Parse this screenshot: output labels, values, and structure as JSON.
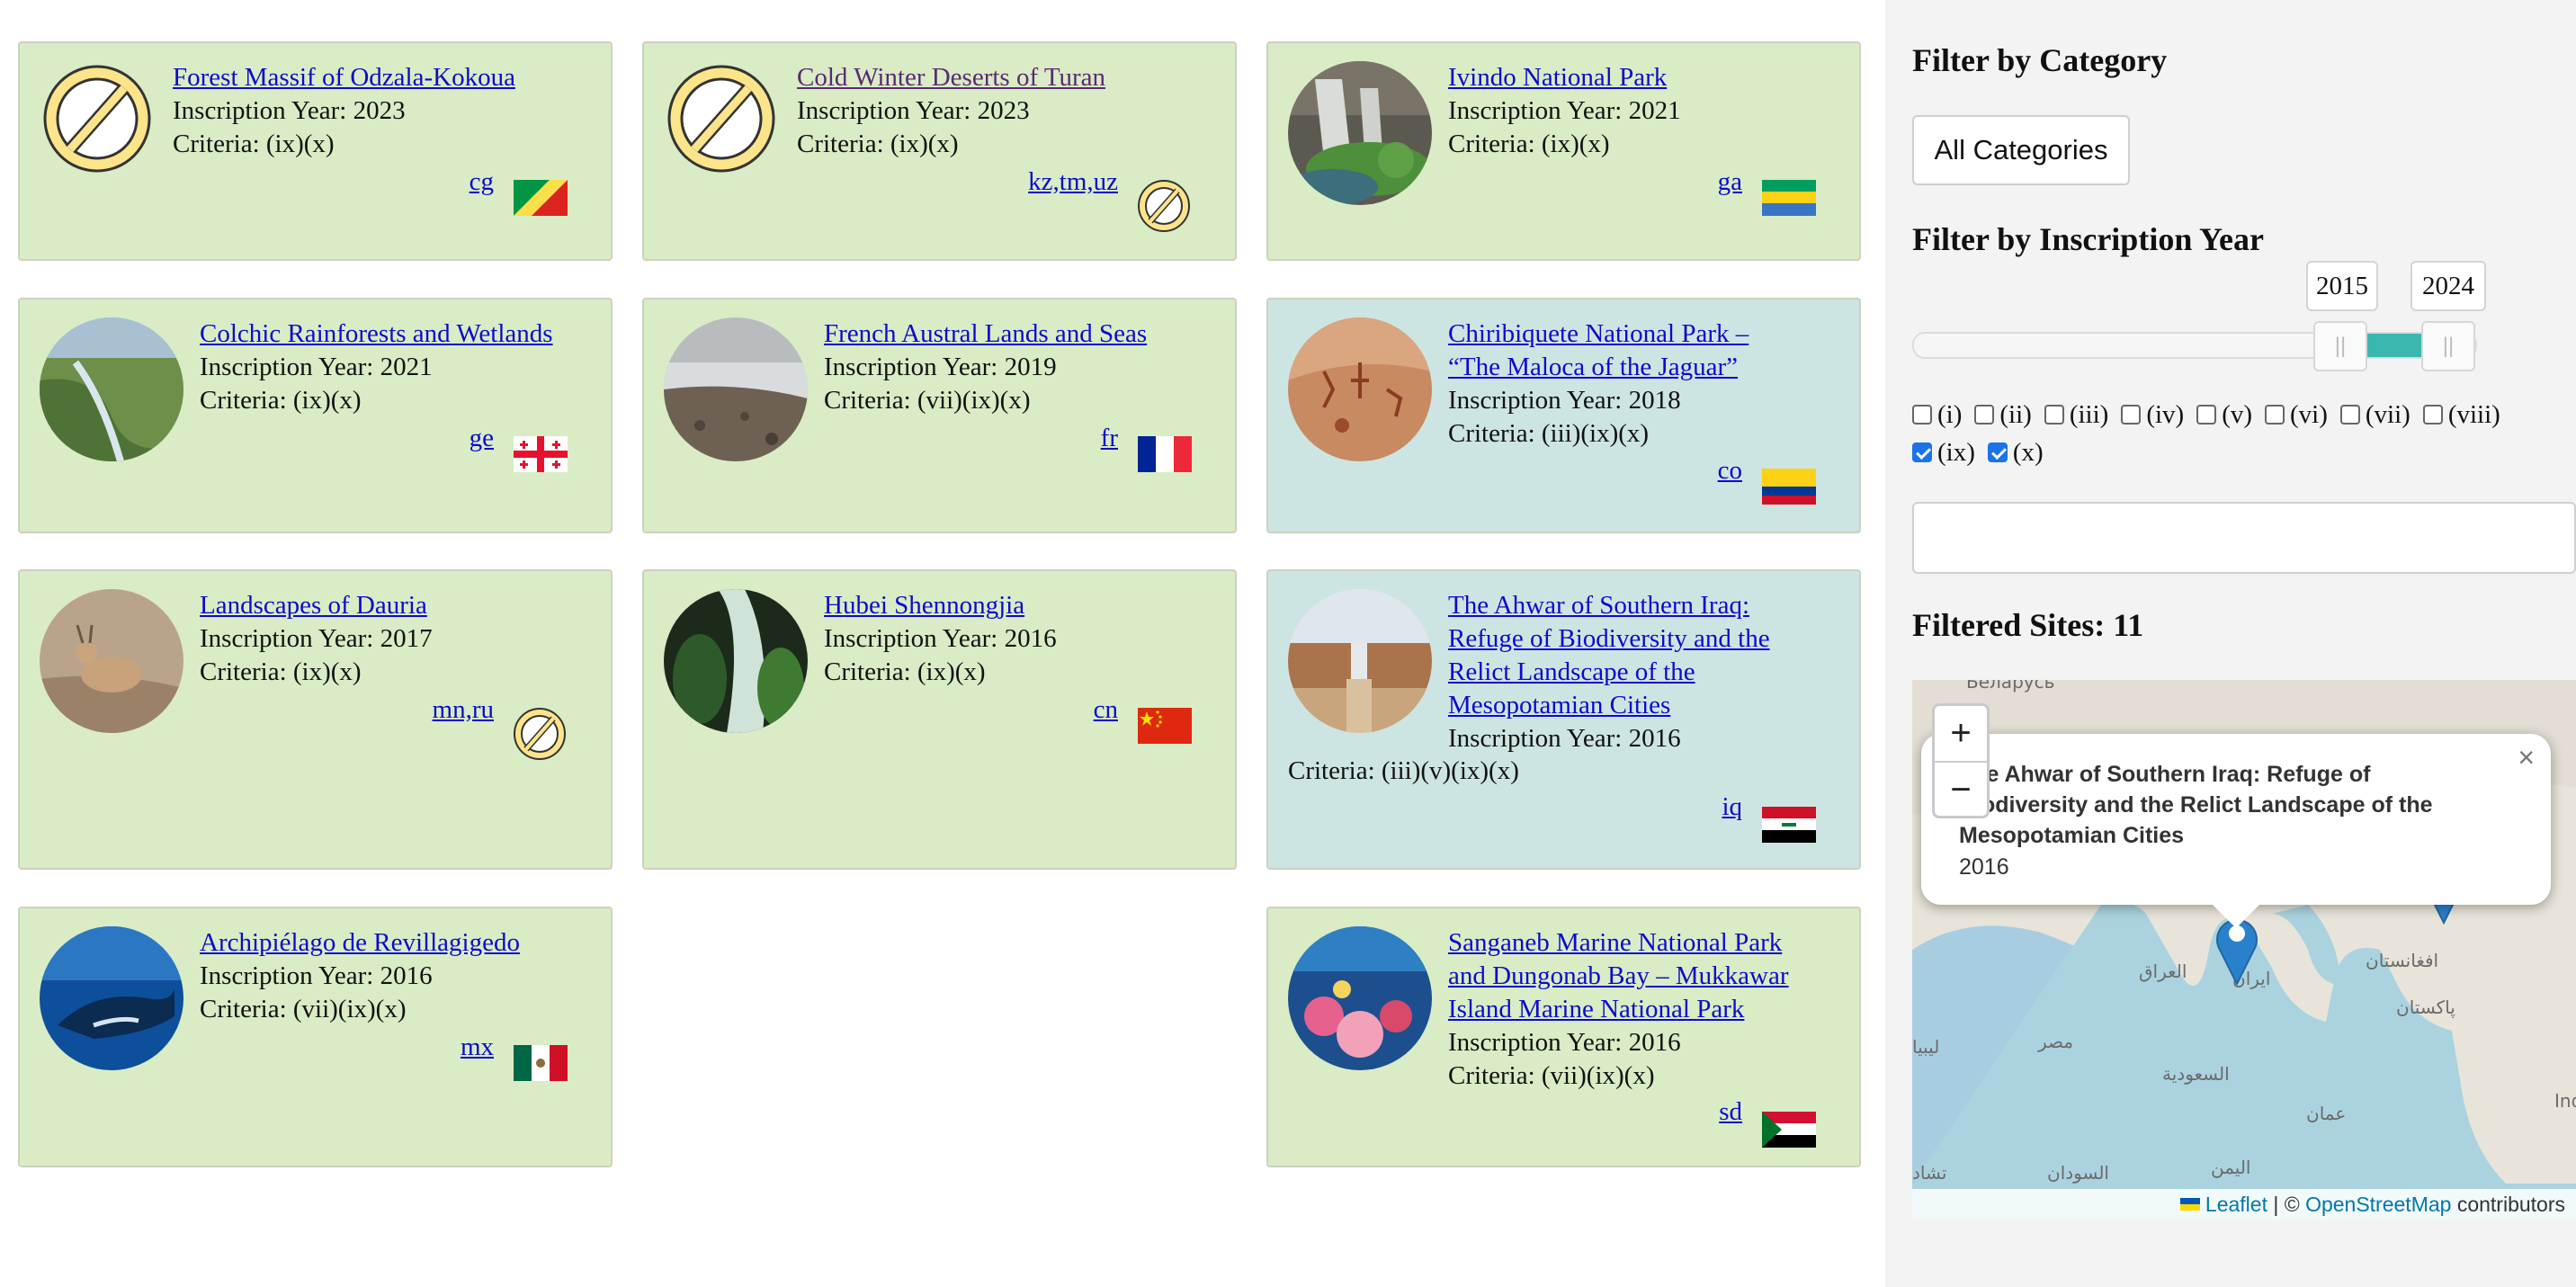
{
  "sites": [
    {
      "name": "Forest Massif of Odzala-Kokoua",
      "year_text": "Inscription Year: 2023",
      "criteria_text": "Criteria: (ix)(x)",
      "codes": "cg",
      "category": "natural",
      "image": "no-image-icon",
      "flag": "flag-cg"
    },
    {
      "name": "Cold Winter Deserts of Turan",
      "year_text": "Inscription Year: 2023",
      "criteria_text": "Criteria: (ix)(x)",
      "codes": "kz,tm,uz",
      "category": "natural",
      "image": "no-image-icon",
      "flag": "no-flag-icon"
    },
    {
      "name": "Ivindo National Park",
      "year_text": "Inscription Year: 2021",
      "criteria_text": "Criteria: (ix)(x)",
      "codes": "ga",
      "category": "natural",
      "image": "waterfall-photo",
      "flag": "flag-ga"
    },
    {
      "name": "Colchic Rainforests and Wetlands",
      "year_text": "Inscription Year: 2021",
      "criteria_text": "Criteria: (ix)(x)",
      "codes": "ge",
      "category": "natural",
      "image": "wetland-photo",
      "flag": "flag-ge"
    },
    {
      "name": "French Austral Lands and Seas",
      "year_text": "Inscription Year: 2019",
      "criteria_text": "Criteria: (vii)(ix)(x)",
      "codes": "fr",
      "category": "natural",
      "image": "coast-photo",
      "flag": "flag-fr"
    },
    {
      "name_lines": [
        "Chiribiquete National Park –",
        "“The Maloca of the Jaguar”"
      ],
      "year_text": "Inscription Year: 2018",
      "criteria_text": "Criteria: (iii)(ix)(x)",
      "codes": "co",
      "category": "mixed",
      "image": "rock-art-photo",
      "flag": "flag-co"
    },
    {
      "name": "Landscapes of Dauria",
      "year_text": "Inscription Year: 2017",
      "criteria_text": "Criteria: (ix)(x)",
      "codes": "mn,ru",
      "category": "natural",
      "image": "gazelle-photo",
      "flag": "no-flag-icon"
    },
    {
      "name": "Hubei Shennongjia",
      "year_text": "Inscription Year: 2016",
      "criteria_text": "Criteria: (ix)(x)",
      "codes": "cn",
      "category": "natural",
      "image": "cave-photo",
      "flag": "flag-cn"
    },
    {
      "name_lines": [
        "The Ahwar of Southern Iraq:",
        "Refuge of Biodiversity and the",
        "Relict Landscape of the",
        "Mesopotamian Cities"
      ],
      "year_text": "Inscription Year: 2016",
      "criteria_text": "Criteria: (iii)(v)(ix)(x)",
      "codes": "iq",
      "category": "mixed",
      "image": "ruins-photo",
      "flag": "flag-iq"
    },
    {
      "name": "Archipiélago de Revillagigedo",
      "year_text": "Inscription Year: 2016",
      "criteria_text": "Criteria: (vii)(ix)(x)",
      "codes": "mx",
      "category": "natural",
      "image": "whale-photo",
      "flag": "flag-mx"
    },
    {
      "name_lines": [
        "Sanganeb Marine National Park",
        "and Dungonab Bay – Mukkawar",
        "Island Marine National Park"
      ],
      "year_text": "Inscription Year: 2016",
      "criteria_text": "Criteria: (vii)(ix)(x)",
      "codes": "sd",
      "category": "natural",
      "image": "coral-photo",
      "flag": "flag-sd"
    }
  ],
  "sidebar": {
    "category_heading": "Filter by Category",
    "category_select": "All Categories",
    "year_heading": "Filter by Inscription Year",
    "year_from": "2015",
    "year_to": "2024",
    "year_range_fraction": [
      0.85,
      1.0
    ],
    "criteria": [
      {
        "label": "(i)",
        "checked": false
      },
      {
        "label": "(ii)",
        "checked": false
      },
      {
        "label": "(iii)",
        "checked": false
      },
      {
        "label": "(iv)",
        "checked": false
      },
      {
        "label": "(v)",
        "checked": false
      },
      {
        "label": "(vi)",
        "checked": false
      },
      {
        "label": "(vii)",
        "checked": false
      },
      {
        "label": "(viii)",
        "checked": false
      },
      {
        "label": "(ix)",
        "checked": true
      },
      {
        "label": "(x)",
        "checked": true
      }
    ],
    "search_value": "",
    "filtered_text": "Filtered Sites: 11"
  },
  "map": {
    "zoom_in": "+",
    "zoom_out": "−",
    "popup_title": "The Ahwar of Southern Iraq: Refuge of Biodiversity and the Relict Landscape of the Mesopotamian Cities",
    "popup_year": "2016",
    "popup_close": "×",
    "labels": {
      "belarus": "Беларусь",
      "iraq": "العراق",
      "iran": "ایران",
      "afghanistan": "افغانستان",
      "pakistan": "پاکستان",
      "saudi": "السعودية",
      "egypt": "مصر",
      "libya": "ليبيا",
      "oman": "عمان",
      "yemen": "اليمن",
      "sudan": "السودان",
      "chad": "تشاد",
      "india": "Ind"
    },
    "attribution_leaflet": "Leaflet",
    "attribution_sep": " | © ",
    "attribution_osm": "OpenStreetMap",
    "attribution_tail": " contributors",
    "marker_color": "#2a81cb"
  }
}
